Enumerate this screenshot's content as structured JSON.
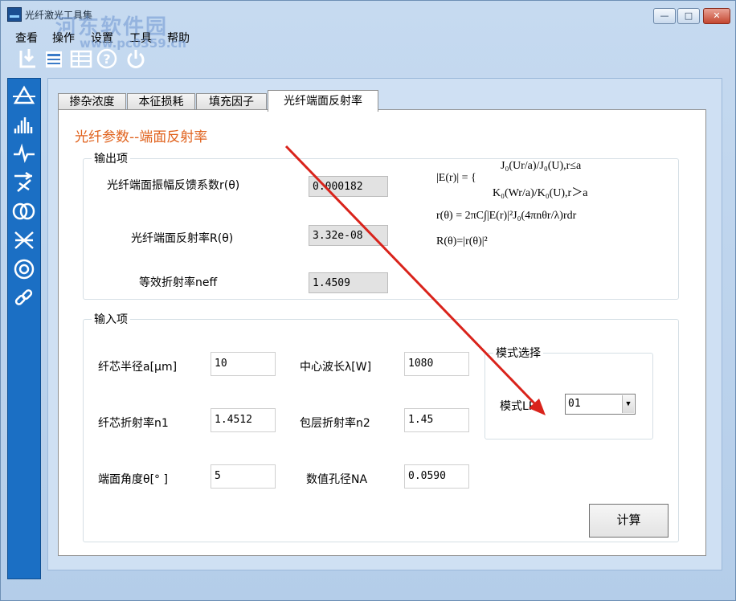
{
  "window": {
    "title": "光纤激光工具集",
    "watermark_title": "河东软件园",
    "watermark_url": "www.pc0359.cn"
  },
  "menu": [
    "查看",
    "操作",
    "设置",
    "工具",
    "帮助"
  ],
  "toolbar": [
    "import-icon",
    "calculator-icon",
    "table-icon",
    "help-icon",
    "power-icon"
  ],
  "sidebar": [
    "prism-icon",
    "spectrum-icon",
    "pulse-icon",
    "beam-splitter-icon",
    "fiber-coil-icon",
    "coupler-icon",
    "ring-icon",
    "link-icon"
  ],
  "tabs": [
    {
      "label": "掺杂浓度",
      "active": false
    },
    {
      "label": "本征损耗",
      "active": false
    },
    {
      "label": "填充因子",
      "active": false
    },
    {
      "label": "光纤端面反射率",
      "active": true
    }
  ],
  "panel": {
    "title": "光纤参数--端面反射率",
    "output": {
      "legend": "输出项",
      "fields": [
        {
          "label": "光纤端面振幅反馈系数r(θ)",
          "value": "0.000182"
        },
        {
          "label": "光纤端面反射率R(θ)",
          "value": "3.32e-08"
        },
        {
          "label": "等效折射率neff",
          "value": "1.4509"
        }
      ],
      "formulas": {
        "f1_left": "|E(r)| = {",
        "f1_top": "J₀(Ur/a)/J₀(U),r≤a",
        "f1_bottom": "K₀(Wr/a)/K₀(U),r＞a",
        "f2": "r(θ) = 2πC∫|E(r)|²J₀(4πnθr/λ)rdr",
        "f3": "R(θ)=|r(θ)|²"
      }
    },
    "input": {
      "legend": "输入项",
      "fields": [
        {
          "label": "纤芯半径a[μm]",
          "value": "10"
        },
        {
          "label": "中心波长λ[W]",
          "value": "1080"
        },
        {
          "label": "纤芯折射率n1",
          "value": "1.4512"
        },
        {
          "label": "包层折射率n2",
          "value": "1.45"
        },
        {
          "label": "端面角度θ[° ]",
          "value": "5"
        },
        {
          "label": "数值孔径NA",
          "value": "0.0590"
        }
      ],
      "mode": {
        "legend": "模式选择",
        "label": "模式LP",
        "selected": "01"
      },
      "calc_label": "计算"
    }
  },
  "colors": {
    "accent_title": "#e0621d",
    "sidebar": "#1b6fc4",
    "annotation_arrow": "#d9231b"
  }
}
